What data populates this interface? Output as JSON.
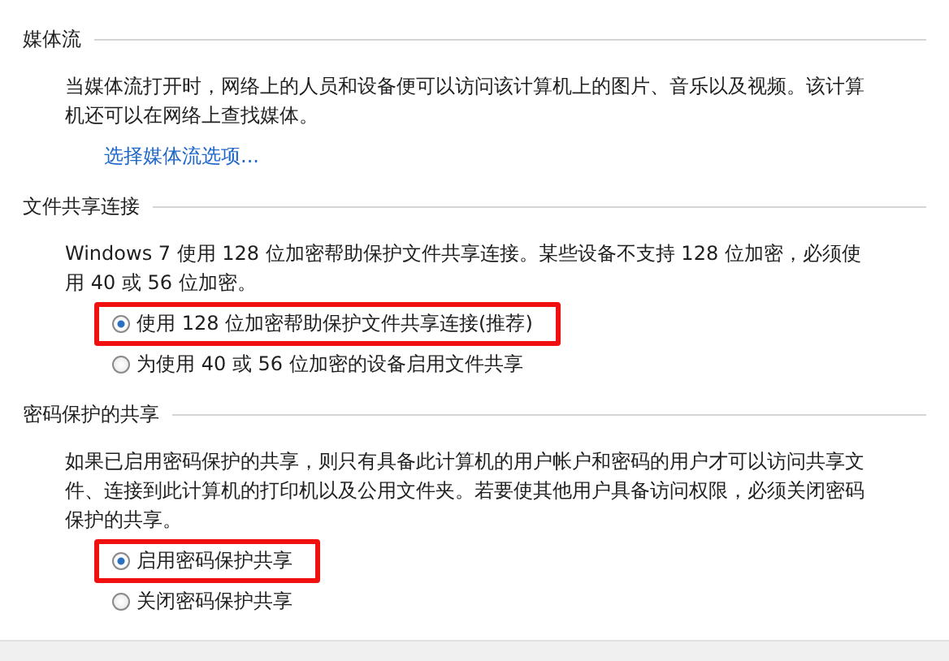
{
  "sections": [
    {
      "title": "媒体流",
      "description": "当媒体流打开时，网络上的人员和设备便可以访问该计算机上的图片、音乐以及视频。该计算机还可以在网络上查找媒体。",
      "link": "选择媒体流选项..."
    },
    {
      "title": "文件共享连接",
      "description": "Windows 7 使用 128 位加密帮助保护文件共享连接。某些设备不支持 128 位加密，必须使用 40 或 56 位加密。",
      "options": [
        {
          "label": "使用 128 位加密帮助保护文件共享连接(推荐)",
          "selected": true,
          "highlighted": true
        },
        {
          "label": "为使用 40 或 56 位加密的设备启用文件共享",
          "selected": false,
          "highlighted": false
        }
      ]
    },
    {
      "title": "密码保护的共享",
      "description": "如果已启用密码保护的共享，则只有具备此计算机的用户帐户和密码的用户才可以访问共享文件、连接到此计算机的打印机以及公用文件夹。若要使其他用户具备访问权限，必须关闭密码保护的共享。",
      "options": [
        {
          "label": "启用密码保护共享",
          "selected": true,
          "highlighted": true
        },
        {
          "label": "关闭密码保护共享",
          "selected": false,
          "highlighted": false
        }
      ]
    }
  ]
}
